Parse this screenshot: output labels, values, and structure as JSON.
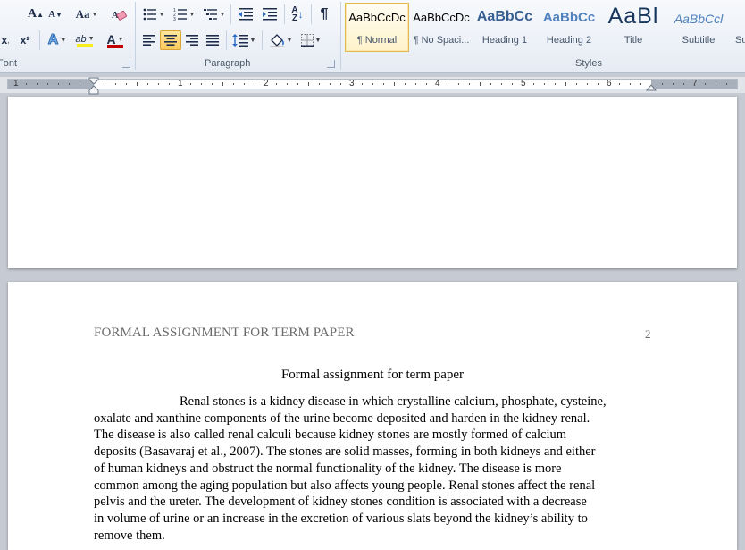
{
  "ribbon": {
    "groups": {
      "font": "Font",
      "paragraph": "Paragraph",
      "styles": "Styles"
    },
    "font_buttons": {
      "grow": "A",
      "shrink": "A",
      "change_case": "Aa",
      "subscript": "x",
      "superscript": "x²",
      "text_effects": "A",
      "highlight": "ab",
      "font_color": "A"
    },
    "paragraph_buttons": {
      "show_marks": "¶",
      "sort": "A↓"
    },
    "styles": [
      {
        "preview": "AaBbCcDc",
        "name": "¶ Normal"
      },
      {
        "preview": "AaBbCcDc",
        "name": "¶ No Spaci..."
      },
      {
        "preview": "AaBbCc",
        "name": "Heading 1"
      },
      {
        "preview": "AaBbCc",
        "name": "Heading 2"
      },
      {
        "preview": "AaBl",
        "name": "Title"
      },
      {
        "preview": "AaBbCcl",
        "name": "Subtitle"
      },
      {
        "preview": "",
        "name": "Su"
      }
    ],
    "colors": {
      "highlight": "#f6ee1e",
      "font_color": "#c00000",
      "heading": "#365f91",
      "heading2": "#4f81bd",
      "subtitle": "#4f81bd"
    }
  },
  "ruler": {
    "numbers": [
      "1",
      "1",
      "2",
      "3",
      "4",
      "5",
      "6",
      "7"
    ]
  },
  "document": {
    "header": "FORMAL ASSIGNMENT FOR TERM PAPER",
    "page_number": "2",
    "title": "Formal assignment for term paper",
    "body_lines": [
      "Renal stones is a kidney disease in which crystalline calcium, phosphate, cysteine,",
      "oxalate and xanthine components of the urine become deposited and harden in the kidney renal.",
      "The disease is also called renal calculi because kidney stones are mostly formed of calcium",
      "deposits (Basavaraj et al., 2007). The stones are solid masses, forming in both kidneys and either",
      "of human kidneys and obstruct the normal functionality of the kidney. The disease is more",
      "common among the aging population but also affects young people. Renal stones affect the renal",
      "pelvis and the ureter. The development of kidney stones condition is associated with a decrease",
      "in volume of urine or an increase in the excretion of various slats beyond the kidney’s ability to",
      "remove them."
    ]
  }
}
